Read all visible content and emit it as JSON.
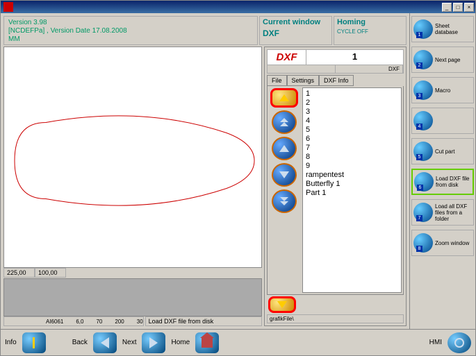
{
  "titlebar": {
    "min": "_",
    "max": "□",
    "close": "×"
  },
  "version": {
    "line1": "Version 3.98",
    "line2": "[NCDEFPa] , Version Date 17.08.2008",
    "line3": "MM"
  },
  "current_window": {
    "title": "Current window",
    "sub": "DXF"
  },
  "homing": {
    "title": "Homing",
    "sub": "CYCLE OFF"
  },
  "coords": {
    "x": "225,00",
    "y": "100,00"
  },
  "ruler": {
    "v1": "AI6061",
    "v2": "6,0",
    "v3": "70",
    "v4": "200",
    "v5": "30"
  },
  "status_text": "Load DXF file from disk",
  "dxf": {
    "label": "DXF",
    "number": "1",
    "sub_right": "DXF",
    "tabs": {
      "file": "File",
      "settings": "Settings",
      "info": "DXF Info"
    },
    "list": [
      "1",
      "2",
      "3",
      "4",
      "5",
      "6",
      "7",
      "8",
      "9",
      "rampentest",
      "Butterfly 1",
      "Part 1"
    ],
    "grafik": "grafikFile\\"
  },
  "sidebar": [
    {
      "num": "1",
      "label": "Sheet database"
    },
    {
      "num": "2",
      "label": "Next page"
    },
    {
      "num": "3",
      "label": "Macro"
    },
    {
      "num": "4",
      "label": ""
    },
    {
      "num": "5",
      "label": "Cut part"
    },
    {
      "num": "6",
      "label": "Load DXF file from disk"
    },
    {
      "num": "7",
      "label": "Load all DXF files from a folder"
    },
    {
      "num": "8",
      "label": "Zoom window"
    }
  ],
  "bottombar": {
    "info": "Info",
    "back": "Back",
    "next": "Next",
    "home": "Home",
    "hmi": "HMI"
  }
}
